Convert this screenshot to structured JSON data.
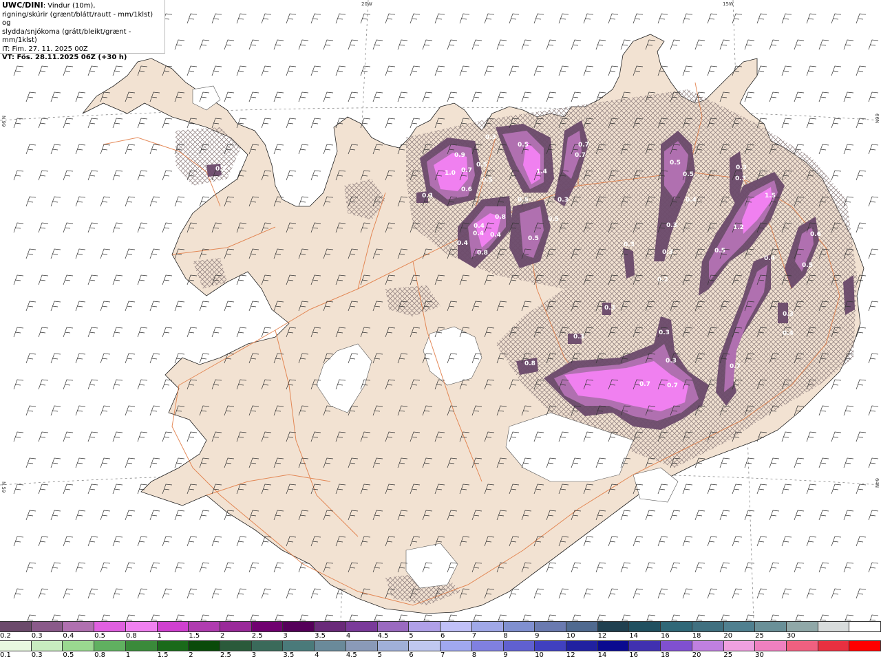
{
  "header": {
    "model": "UWC/DINI",
    "desc_line1": ": Vindur (10m),",
    "desc_line2": "rigning/skúrir (grænt/blátt/rautt - mm/1klst) og",
    "desc_line3": "slydda/snjókoma (grátt/bleikt/grænt - mm/1klst)",
    "it_line": "IT: Fim. 27. 11. 2025 00Z",
    "vt_line": "VT: Fös. 28.11.2025 06Z (+30 h)"
  },
  "coordinates": {
    "lon_20w": "20W",
    "lon_15w": "15W",
    "lat_66n_left": "N.99",
    "lat_66n_right": "66N",
    "lat_65n_left": "N.59",
    "lat_65n_right": "64N"
  },
  "precip_labels": [
    {
      "text": "0.9"
    },
    {
      "text": "0.5"
    },
    {
      "text": "0.7"
    },
    {
      "text": "1.0"
    },
    {
      "text": "0.5"
    },
    {
      "text": "0.6"
    },
    {
      "text": "0.3"
    },
    {
      "text": "0.4"
    },
    {
      "text": "0.5"
    },
    {
      "text": "1.4"
    },
    {
      "text": "0.7"
    },
    {
      "text": "0.7"
    },
    {
      "text": "0.5"
    },
    {
      "text": "0.3"
    },
    {
      "text": "0.8"
    },
    {
      "text": "0.4"
    },
    {
      "text": "0.4"
    },
    {
      "text": "0.4"
    },
    {
      "text": "0.8"
    },
    {
      "text": "0.5"
    },
    {
      "text": "0.5"
    },
    {
      "text": "0.3"
    },
    {
      "text": "0.2"
    },
    {
      "text": "0.5"
    },
    {
      "text": "0.5"
    },
    {
      "text": "0.4"
    },
    {
      "text": "0.3"
    },
    {
      "text": "0.3"
    },
    {
      "text": "0.3"
    },
    {
      "text": "1.5"
    },
    {
      "text": "1.2"
    },
    {
      "text": "0.6"
    },
    {
      "text": "0.5"
    },
    {
      "text": "0.4"
    },
    {
      "text": "0.5"
    },
    {
      "text": "0.3"
    },
    {
      "text": "0.3"
    },
    {
      "text": "0.3"
    },
    {
      "text": "0.4"
    },
    {
      "text": "0.8"
    },
    {
      "text": "0.7"
    },
    {
      "text": "0.7"
    },
    {
      "text": "0.3"
    },
    {
      "text": "0.7"
    },
    {
      "text": "0.3"
    },
    {
      "text": "0.3"
    },
    {
      "text": "0.3"
    },
    {
      "text": "0.2"
    }
  ],
  "snow_scale": {
    "colors": [
      "#6b4a6b",
      "#8a5a8a",
      "#b070b0",
      "#e060e0",
      "#f080f0",
      "#d040d0",
      "#b03cb0",
      "#9a2a9a",
      "#700070",
      "#55005a",
      "#6a2a7a",
      "#7a3a9a",
      "#9a6ac0",
      "#b0a0e8",
      "#c0c0f8",
      "#a0a8e8",
      "#8090d0",
      "#6a7ab0",
      "#506a90",
      "#204050",
      "#205060",
      "#306878",
      "#407080",
      "#508090",
      "#6a9098",
      "#90a8a8",
      "#d8dcdc",
      "#ffffff"
    ],
    "labels": [
      "0.2",
      "0.3",
      "0.4",
      "0.5",
      "0.8",
      "1",
      "1.5",
      "2",
      "2.5",
      "3",
      "3.5",
      "4",
      "4.5",
      "5",
      "6",
      "7",
      "8",
      "9",
      "10",
      "12",
      "14",
      "16",
      "18",
      "20",
      "25",
      "30"
    ]
  },
  "rain_scale": {
    "colors": [
      "#e8f8e0",
      "#c8ecc0",
      "#9ad890",
      "#60b060",
      "#3a8a3a",
      "#1a6a1a",
      "#0a4a0a",
      "#2a5a3a",
      "#3a6a5a",
      "#4a7a7a",
      "#6a8a9a",
      "#8a9ab8",
      "#a0b0d8",
      "#c0c8f0",
      "#a0a8f0",
      "#8080e0",
      "#6060d0",
      "#4040c0",
      "#2020a0",
      "#0a0a90",
      "#4030b0",
      "#8050d0",
      "#c080e0",
      "#f0a0e0",
      "#f080c0",
      "#f06080",
      "#e83040",
      "#ff0000"
    ],
    "labels": [
      "0.1",
      "0.3",
      "0.5",
      "0.8",
      "1",
      "1.5",
      "2",
      "2.5",
      "3",
      "3.5",
      "4",
      "4.5",
      "5",
      "6",
      "7",
      "8",
      "9",
      "10",
      "12",
      "14",
      "16",
      "18",
      "20",
      "25",
      "30"
    ]
  },
  "colors": {
    "land": "#f2e2d2",
    "road": "#e07840",
    "snow_dark": "#6b4a6b",
    "snow_mid": "#b070b0",
    "snow_bright": "#f080f0",
    "hatch": "#8a7a7a",
    "wind_barb": "#333333",
    "glacier": "#ffffff"
  }
}
